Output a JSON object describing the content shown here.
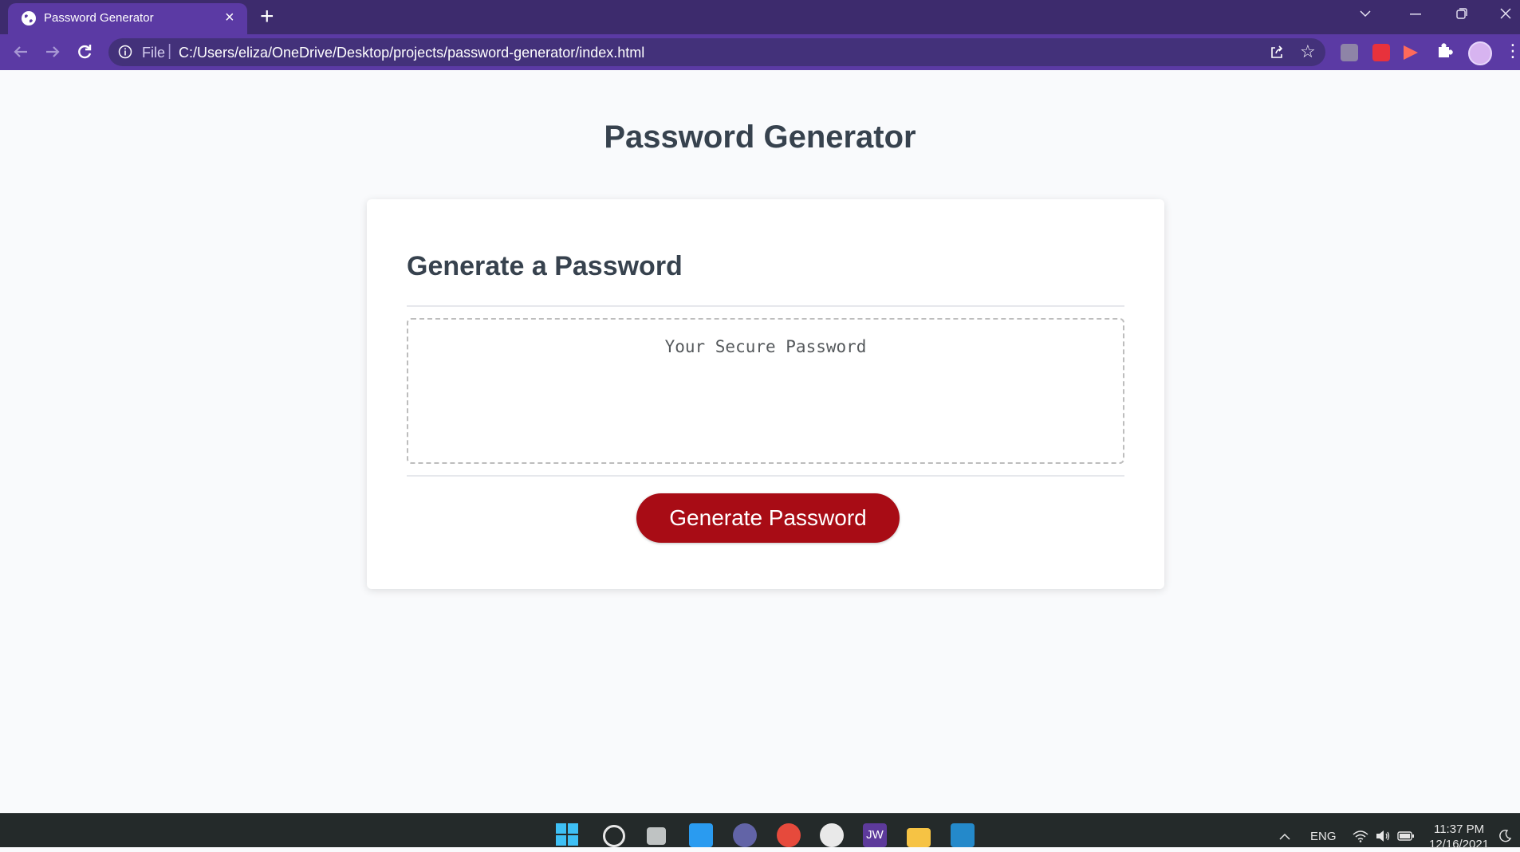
{
  "browser": {
    "tab_title": "Password Generator",
    "tab_close": "×",
    "new_tab": "+",
    "scheme_label": "File",
    "url": "C:/Users/eliza/OneDrive/Desktop/projects/password-generator/index.html",
    "icons": [
      "globe-icon",
      "close-icon",
      "plus-icon",
      "chevron-down-icon",
      "minimize-icon",
      "restore-icon",
      "close-window-icon",
      "back-icon",
      "forward-icon",
      "reload-icon",
      "info-icon",
      "share-icon",
      "star-icon",
      "pdf-extension-icon",
      "red-extension-icon",
      "play-extension-icon",
      "puzzle-icon",
      "avatar",
      "kebab-menu-icon"
    ]
  },
  "page": {
    "title": "Password Generator",
    "card_title": "Generate a Password",
    "password_placeholder": "Your Secure Password",
    "password_value": "",
    "generate_button": "Generate Password"
  },
  "taskbar": {
    "jw_label": "JW",
    "language": "ENG",
    "time": "11:37 PM",
    "date": "12/16/2021",
    "icons": [
      "windows-start-icon",
      "search-icon",
      "task-view-icon",
      "widgets-icon",
      "teams-icon",
      "chrome-icon",
      "slack-icon",
      "jw-icon",
      "file-explorer-icon",
      "vscode-icon",
      "chevron-up-icon",
      "wifi-icon",
      "volume-icon",
      "battery-icon",
      "moon-icon"
    ]
  },
  "colors": {
    "browser_frame": "#3d2b6d",
    "toolbar": "#5b3aa4",
    "page_background": "#f9fafc",
    "heading": "#37424e",
    "button": "#a80c15",
    "button_text": "#ffffff",
    "taskbar": "#242a2a"
  }
}
